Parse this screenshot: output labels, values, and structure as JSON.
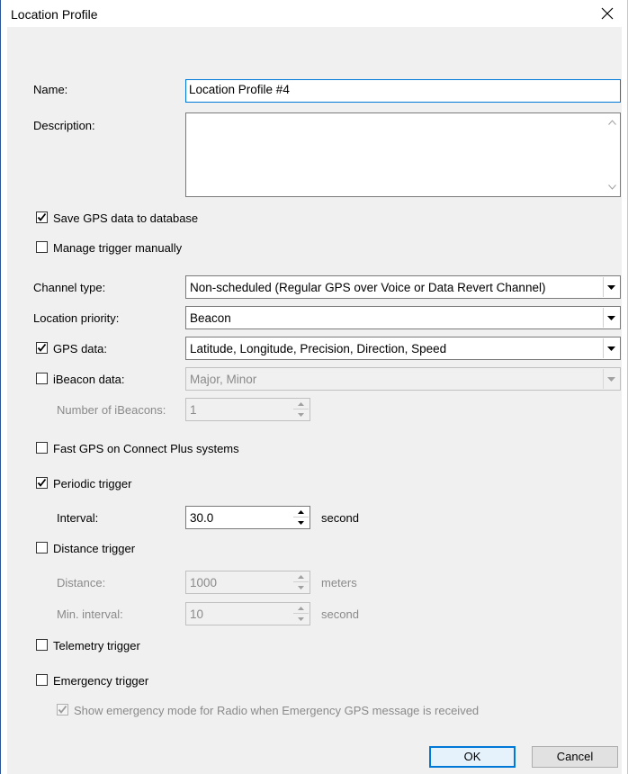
{
  "window": {
    "title": "Location Profile"
  },
  "name": {
    "label": "Name:",
    "value": "Location Profile #4"
  },
  "description": {
    "label": "Description:",
    "value": ""
  },
  "save_gps": {
    "label": "Save GPS data to database",
    "checked": true
  },
  "manage_trigger": {
    "label": "Manage trigger manually",
    "checked": false
  },
  "channel_type": {
    "label": "Channel type:",
    "value": "Non-scheduled (Regular GPS over Voice or Data Revert Channel)"
  },
  "location_priority": {
    "label": "Location priority:",
    "value": "Beacon"
  },
  "gps_data": {
    "label": "GPS data:",
    "checked": true,
    "value": "Latitude, Longitude, Precision, Direction, Speed"
  },
  "ibeacon_data": {
    "label": "iBeacon data:",
    "checked": false,
    "value": "Major, Minor"
  },
  "num_ibeacons": {
    "label": "Number of iBeacons:",
    "value": "1"
  },
  "fast_gps": {
    "label": "Fast GPS on Connect Plus systems",
    "checked": false
  },
  "periodic_trigger": {
    "label": "Periodic trigger",
    "checked": true
  },
  "interval": {
    "label": "Interval:",
    "value": "30.0",
    "unit": "second"
  },
  "distance_trigger": {
    "label": "Distance trigger",
    "checked": false
  },
  "distance": {
    "label": "Distance:",
    "value": "1000",
    "unit": "meters"
  },
  "min_interval": {
    "label": "Min. interval:",
    "value": "10",
    "unit": "second"
  },
  "telemetry_trigger": {
    "label": "Telemetry trigger",
    "checked": false
  },
  "emergency_trigger": {
    "label": "Emergency trigger",
    "checked": false
  },
  "show_emergency": {
    "label": "Show emergency mode for Radio when Emergency GPS message is received",
    "checked": true
  },
  "buttons": {
    "ok": "OK",
    "cancel": "Cancel"
  }
}
